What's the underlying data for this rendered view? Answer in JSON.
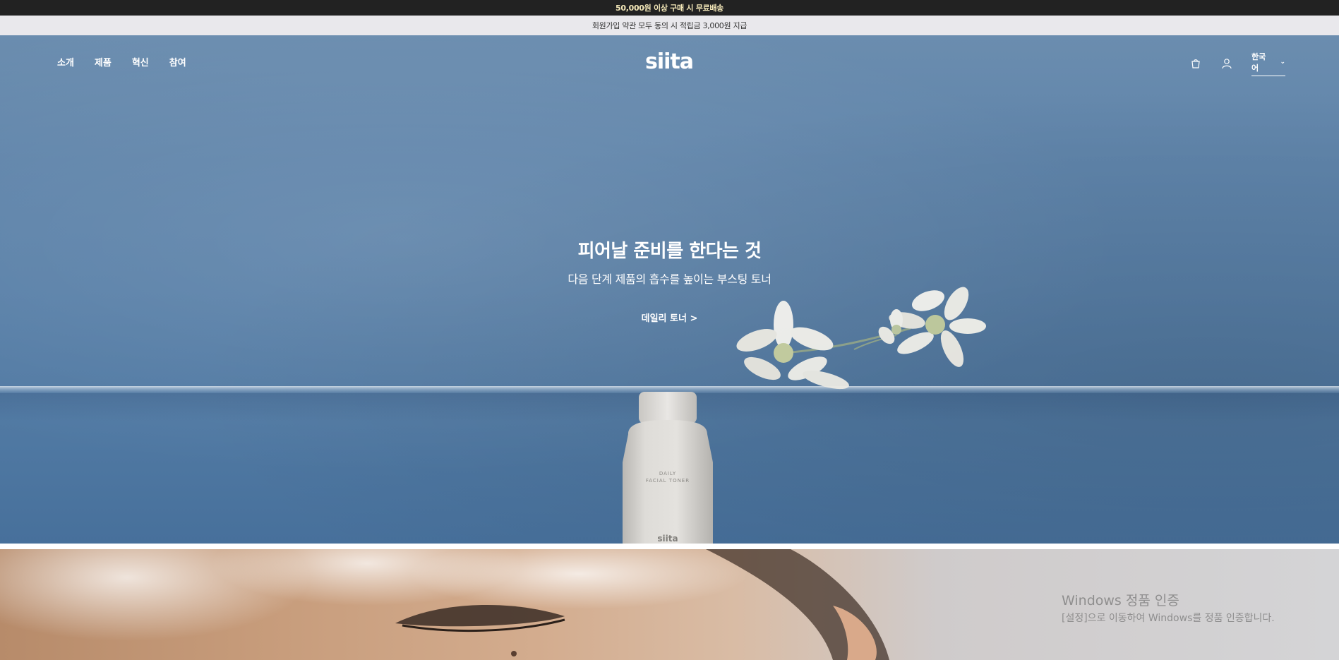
{
  "announcement": {
    "top": "50,000원 이상 구매 시 무료배송",
    "sub": "회원가입 약관 모두 동의 시 적립금 3,000원 지급"
  },
  "nav": {
    "links": [
      "소개",
      "제품",
      "혁신",
      "참여"
    ],
    "logo_text": "siita",
    "language": "한국어",
    "icons": [
      "cart-icon",
      "user-icon",
      "chevron-down-icon"
    ]
  },
  "hero": {
    "title": "피어날 준비를 한다는 것",
    "subtitle": "다음 단계 제품의 흡수를 높이는 부스팅 토너",
    "cta": "데일리 토너 >",
    "bottle_label_1": "DAILY",
    "bottle_label_2": "FACIAL TONER",
    "bottle_brand": "siita"
  },
  "watermark": {
    "title": "Windows 정품 인증",
    "subtitle": "[설정]으로 이동하여 Windows를 정품 인증합니다."
  },
  "colors": {
    "topbar_bg": "#222222",
    "topbar_text": "#f3e7b8",
    "subbar_bg": "#e9e8ec",
    "hero_bg": "#5980a8"
  }
}
